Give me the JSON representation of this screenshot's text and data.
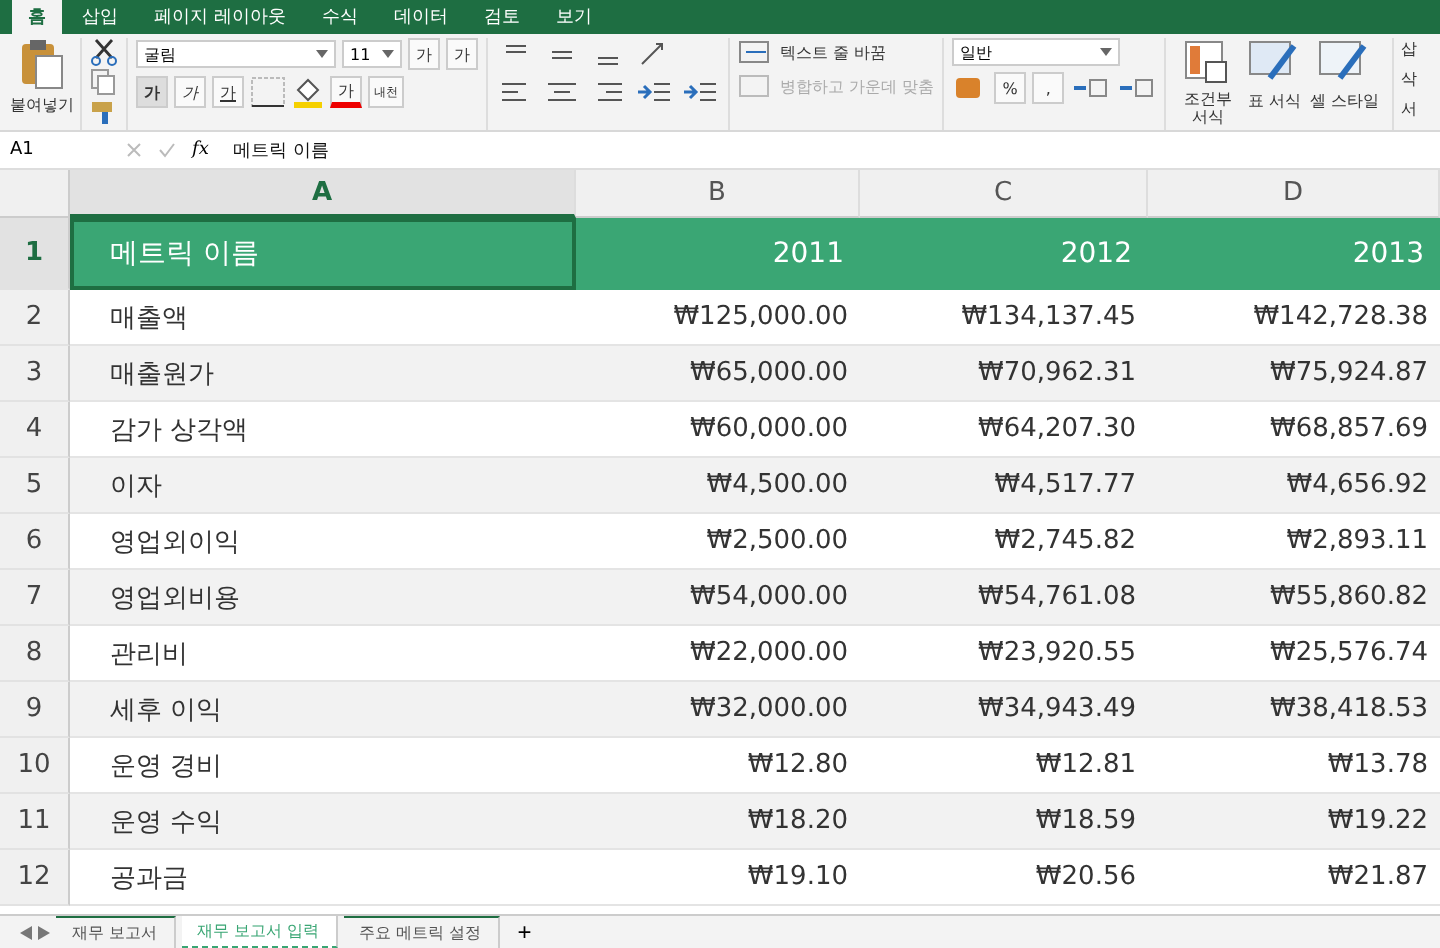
{
  "ribbon_tabs": [
    {
      "label": "홈",
      "selected": true
    },
    {
      "label": "삽입",
      "selected": false
    },
    {
      "label": "페이지 레이아웃",
      "selected": false
    },
    {
      "label": "수식",
      "selected": false
    },
    {
      "label": "데이터",
      "selected": false
    },
    {
      "label": "검토",
      "selected": false
    },
    {
      "label": "보기",
      "selected": false
    }
  ],
  "ribbon": {
    "paste": "붙여넣기",
    "font": "굴림",
    "size": "11",
    "grow": "가",
    "shrink": "가",
    "bold": "가",
    "italic": "가",
    "underline": "가",
    "font_color": "가",
    "phonetic": "내천",
    "wrap": "텍스트 줄 바꿈",
    "merge": "병합하고 가운데 맞춤",
    "number_format": "일반",
    "percent": "%",
    "comma": ",",
    "conditional": "조건부 서식",
    "table_format": "표 서식",
    "cell_style": "셀 스타일",
    "insert": "삽",
    "delete": "삭",
    "format": "서"
  },
  "formula_bar": {
    "cell": "A1",
    "fx": "fx",
    "value": "메트릭 이름"
  },
  "columns": [
    "A",
    "B",
    "C",
    "D"
  ],
  "header_row": {
    "number": "1",
    "cells": [
      "메트릭 이름",
      "2011",
      "2012",
      "2013"
    ]
  },
  "rows": [
    {
      "number": "2",
      "cells": [
        "매출액",
        "₩125,000.00",
        "₩134,137.45",
        "₩142,728.38"
      ]
    },
    {
      "number": "3",
      "cells": [
        "매출원가",
        "₩65,000.00",
        "₩70,962.31",
        "₩75,924.87"
      ]
    },
    {
      "number": "4",
      "cells": [
        "감가 상각액",
        "₩60,000.00",
        "₩64,207.30",
        "₩68,857.69"
      ]
    },
    {
      "number": "5",
      "cells": [
        "이자",
        "₩4,500.00",
        "₩4,517.77",
        "₩4,656.92"
      ]
    },
    {
      "number": "6",
      "cells": [
        "영업외이익",
        "₩2,500.00",
        "₩2,745.82",
        "₩2,893.11"
      ]
    },
    {
      "number": "7",
      "cells": [
        "영업외비용",
        "₩54,000.00",
        "₩54,761.08",
        "₩55,860.82"
      ]
    },
    {
      "number": "8",
      "cells": [
        "관리비",
        "₩22,000.00",
        "₩23,920.55",
        "₩25,576.74"
      ]
    },
    {
      "number": "9",
      "cells": [
        "세후 이익",
        "₩32,000.00",
        "₩34,943.49",
        "₩38,418.53"
      ]
    },
    {
      "number": "10",
      "cells": [
        "운영 경비",
        "₩12.80",
        "₩12.81",
        "₩13.78"
      ]
    },
    {
      "number": "11",
      "cells": [
        "운영 수익",
        "₩18.20",
        "₩18.59",
        "₩19.22"
      ]
    },
    {
      "number": "12",
      "cells": [
        "공과금",
        "₩19.10",
        "₩20.56",
        "₩21.87"
      ]
    }
  ],
  "sheet_tabs": [
    {
      "label": "재무 보고서",
      "selected": false
    },
    {
      "label": "재무 보고서 입력",
      "selected": true
    },
    {
      "label": "주요 메트릭 설정",
      "selected": false
    }
  ],
  "add_sheet": "+"
}
